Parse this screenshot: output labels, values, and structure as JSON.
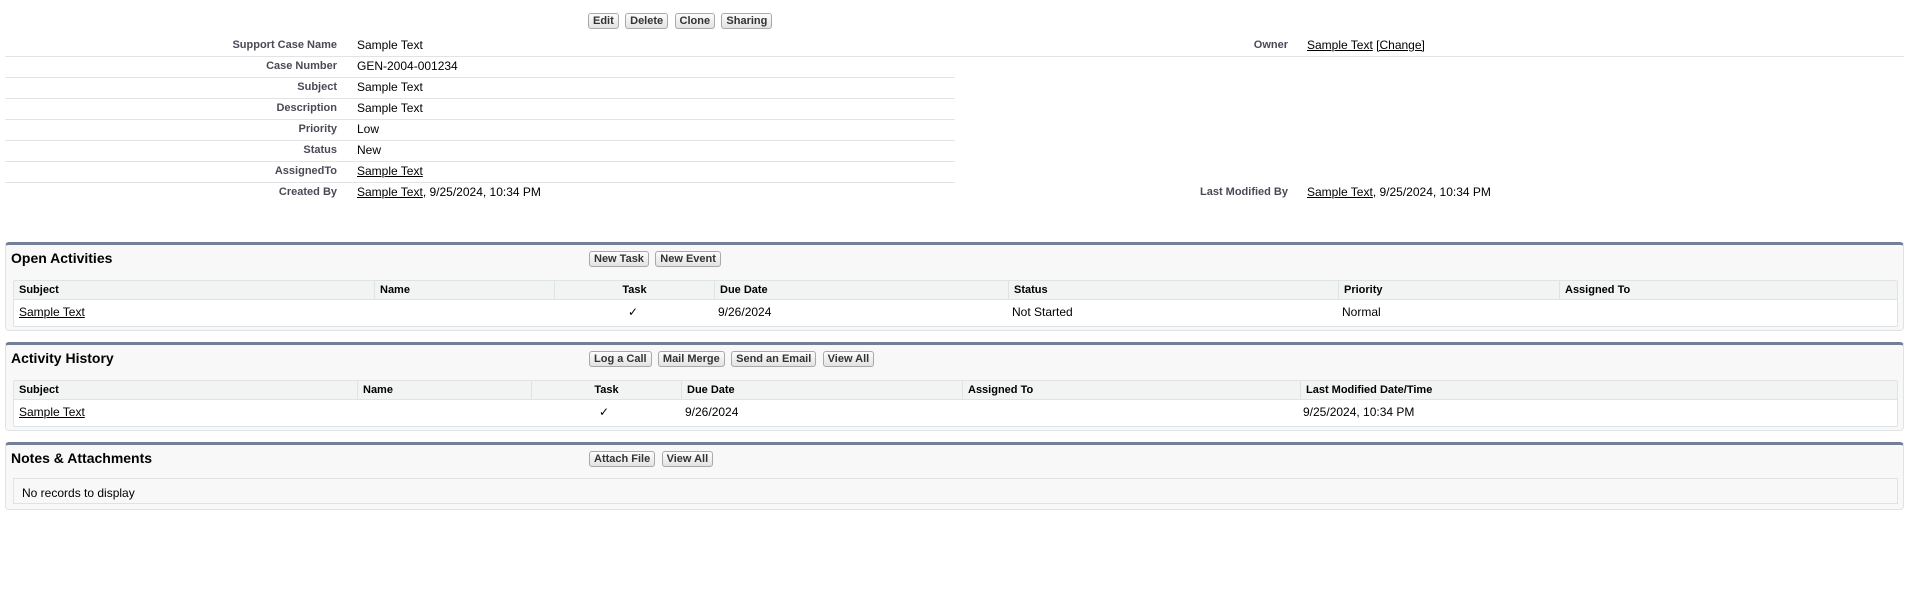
{
  "top_buttons": {
    "edit": "Edit",
    "delete": "Delete",
    "clone": "Clone",
    "sharing": "Sharing"
  },
  "detail": {
    "support_case_name": {
      "label": "Support Case Name",
      "value": "Sample Text"
    },
    "owner": {
      "label": "Owner",
      "value": "Sample Text",
      "change": "[Change]"
    },
    "case_number": {
      "label": "Case Number",
      "value": "GEN-2004-001234"
    },
    "subject": {
      "label": "Subject",
      "value": "Sample Text"
    },
    "description": {
      "label": "Description",
      "value": "Sample Text"
    },
    "priority": {
      "label": "Priority",
      "value": "Low"
    },
    "status": {
      "label": "Status",
      "value": "New"
    },
    "assigned_to": {
      "label": "AssignedTo",
      "value": "Sample Text"
    },
    "created_by": {
      "label": "Created By",
      "user": "Sample Text",
      "date": ", 9/25/2024, 10:34 PM"
    },
    "last_modified_by": {
      "label": "Last Modified By",
      "user": "Sample Text",
      "date": ", 9/25/2024, 10:34 PM"
    }
  },
  "open_activities": {
    "title": "Open Activities",
    "buttons": [
      "New Task",
      "New Event"
    ],
    "columns": [
      "Subject",
      "Name",
      "Task",
      "Due Date",
      "Status",
      "Priority",
      "Assigned To"
    ],
    "rows": [
      {
        "subject": "Sample Text",
        "name": "",
        "task": "✓",
        "due_date": "9/26/2024",
        "status": "Not Started",
        "priority": "Normal",
        "assigned_to": ""
      }
    ]
  },
  "activity_history": {
    "title": "Activity History",
    "buttons": [
      "Log a Call",
      "Mail Merge",
      "Send an Email",
      "View All"
    ],
    "columns": [
      "Subject",
      "Name",
      "Task",
      "Due Date",
      "Assigned To",
      "Last Modified Date/Time"
    ],
    "rows": [
      {
        "subject": "Sample Text",
        "name": "",
        "task": "✓",
        "due_date": "9/26/2024",
        "assigned_to": "",
        "last_modified": "9/25/2024, 10:34 PM"
      }
    ]
  },
  "notes_attachments": {
    "title": "Notes & Attachments",
    "buttons": [
      "Attach File",
      "View All"
    ],
    "empty_text": "No records to display"
  }
}
